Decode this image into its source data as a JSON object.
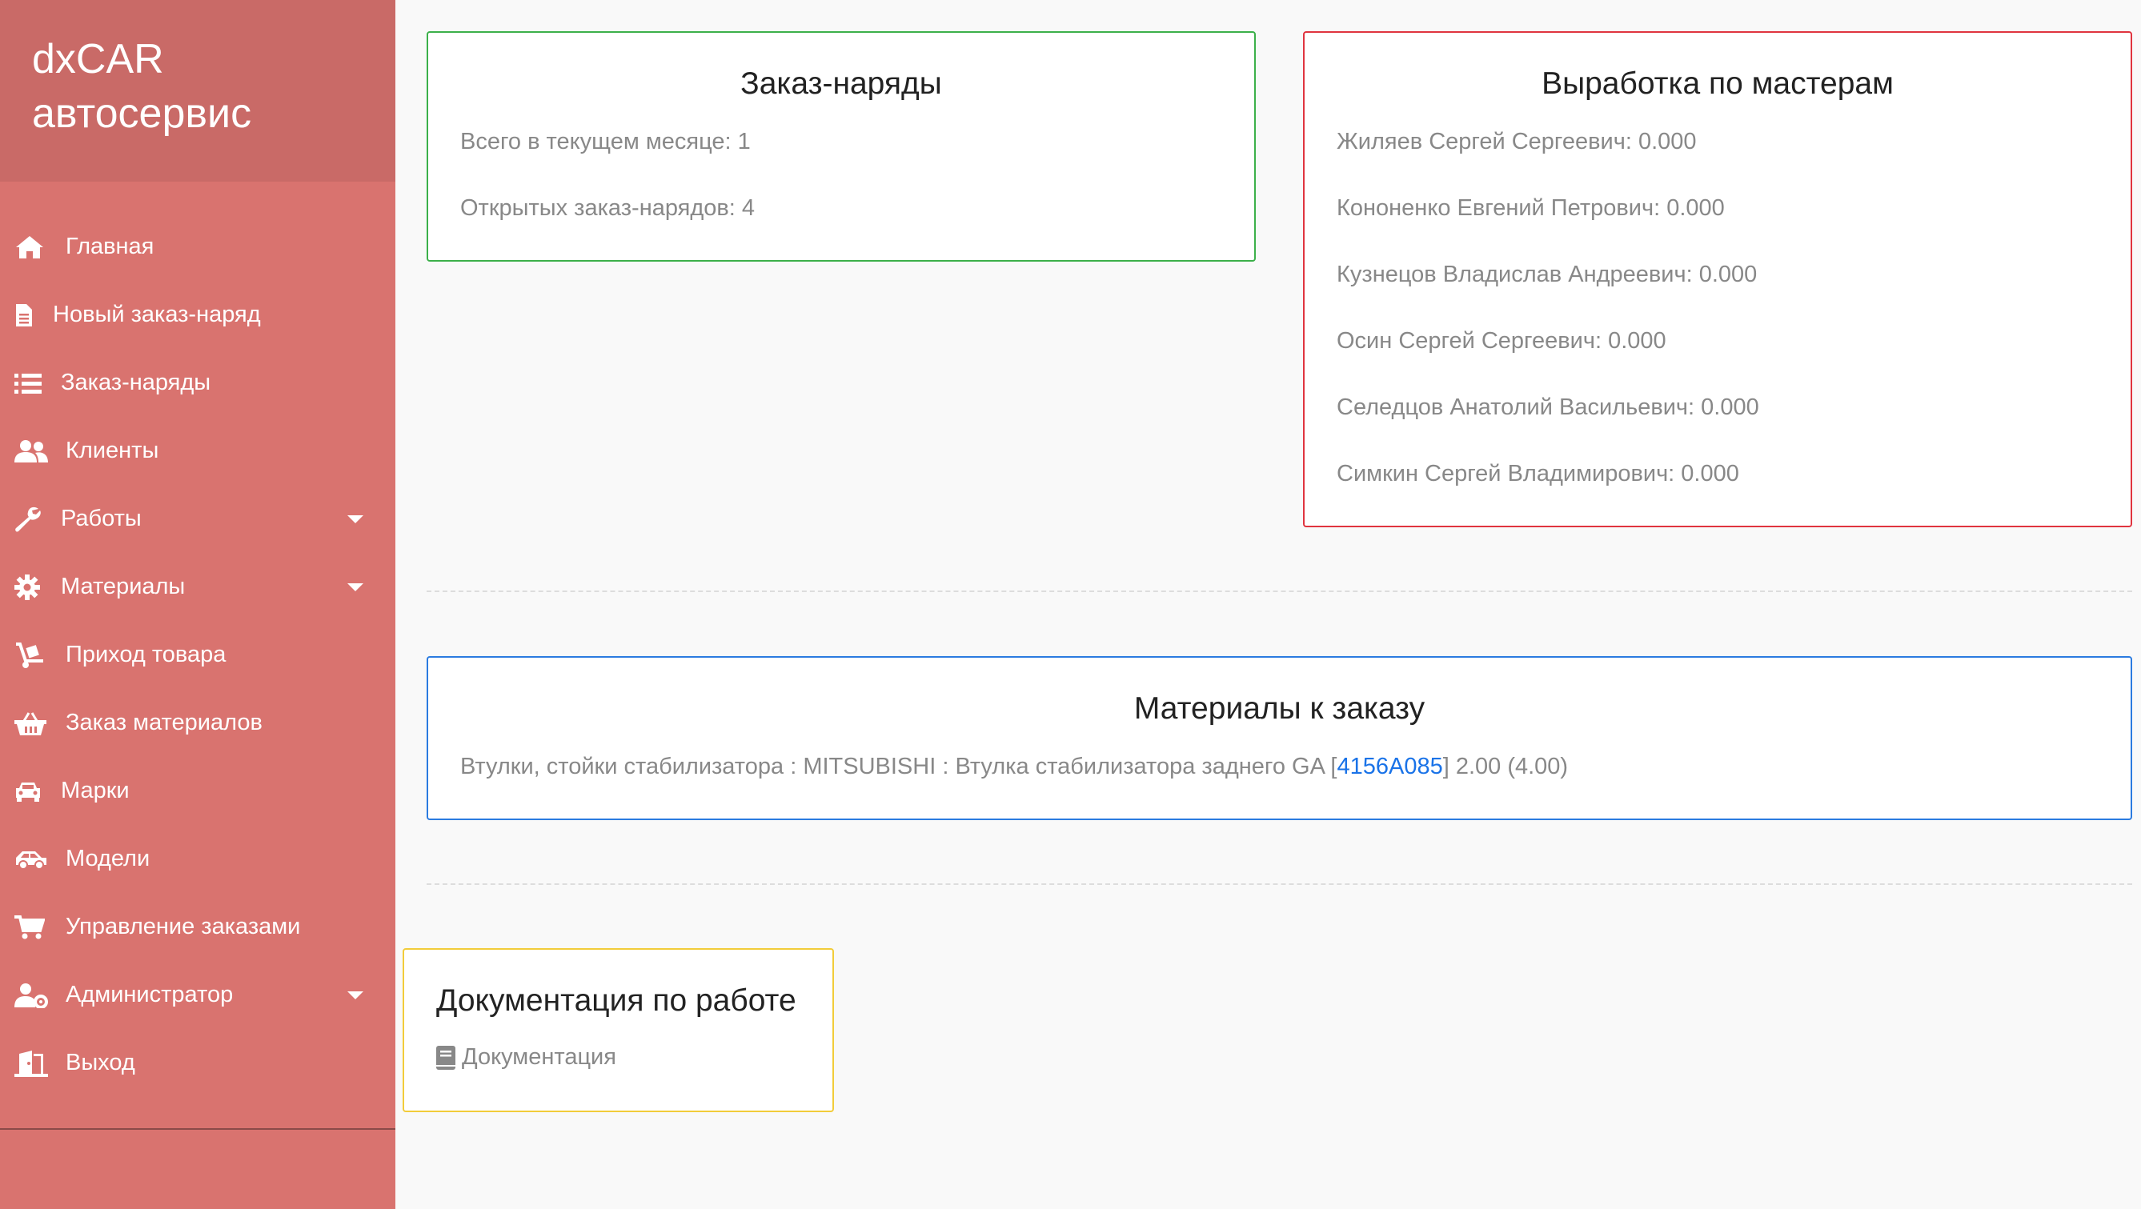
{
  "brand": {
    "line1": "dxCAR",
    "line2": "автосервис"
  },
  "nav": [
    {
      "label": "Главная",
      "icon": "home-icon",
      "has_submenu": false
    },
    {
      "label": "Новый заказ-наряд",
      "icon": "document-icon",
      "has_submenu": false
    },
    {
      "label": "Заказ-наряды",
      "icon": "list-icon",
      "has_submenu": false
    },
    {
      "label": "Клиенты",
      "icon": "users-icon",
      "has_submenu": false
    },
    {
      "label": "Работы",
      "icon": "wrench-icon",
      "has_submenu": true
    },
    {
      "label": "Материалы",
      "icon": "gear-icon",
      "has_submenu": true
    },
    {
      "label": "Приход товара",
      "icon": "dolly-icon",
      "has_submenu": false
    },
    {
      "label": "Заказ материалов",
      "icon": "basket-icon",
      "has_submenu": false
    },
    {
      "label": "Марки",
      "icon": "car-icon",
      "has_submenu": false
    },
    {
      "label": "Модели",
      "icon": "car-side-icon",
      "has_submenu": false
    },
    {
      "label": "Управление заказами",
      "icon": "cart-icon",
      "has_submenu": false
    },
    {
      "label": "Администратор",
      "icon": "user-cog-icon",
      "has_submenu": true
    },
    {
      "label": "Выход",
      "icon": "door-exit-icon",
      "has_submenu": false
    }
  ],
  "orders_card": {
    "title": "Заказ-наряды",
    "month_total": "Всего в текущем месяце: 1",
    "open_orders": "Открытых заказ-нарядов: 4"
  },
  "masters_card": {
    "title": "Выработка по мастерам",
    "rows": [
      "Жиляев Сергей Сергеевич: 0.000",
      "Кононенко Евгений Петрович: 0.000",
      "Кузнецов Владислав Андреевич: 0.000",
      "Осин Сергей Сергеевич: 0.000",
      "Селедцов Анатолий Васильевич: 0.000",
      "Симкин Сергей Владимирович: 0.000"
    ]
  },
  "materials_card": {
    "title": "Материалы к заказу",
    "item_prefix": "Втулки, стойки стабилизатора : MITSUBISHI : Втулка стабилизатора заднего GA [",
    "item_code": "4156A085",
    "item_suffix": "] 2.00 (4.00)"
  },
  "docs_card": {
    "title": "Документация по работе",
    "link_label": "Документация",
    "link_icon": "book-icon"
  },
  "colors": {
    "sidebar": "#d9736f",
    "brand": "#c96a67",
    "orders_border": "#3cb04a",
    "masters_border": "#e0343f",
    "materials_border": "#2b7be0",
    "docs_border": "#f2cc3a",
    "link": "#1a73e8"
  }
}
